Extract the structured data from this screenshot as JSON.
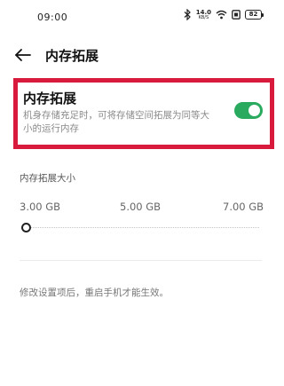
{
  "status_bar": {
    "time": "09:00",
    "net_speed_value": "14.0",
    "net_speed_unit": "KB/S",
    "battery": "82",
    "icons": [
      "bluetooth-icon",
      "wifi-icon",
      "sim-icon",
      "battery-icon"
    ]
  },
  "header": {
    "title": "内存拓展",
    "back_icon": "arrow-left-icon"
  },
  "setting": {
    "title": "内存拓展",
    "description": "机身存储充足时，可将存储空间拓展为同等大小的运行内存",
    "toggle_on": true,
    "toggle_color": "#2aaa5e",
    "highlight_color": "#d81a3c"
  },
  "size_section": {
    "label": "内存拓展大小",
    "options": [
      "3.00 GB",
      "5.00 GB",
      "7.00 GB"
    ],
    "selected_index": 0
  },
  "footer": {
    "note": "修改设置项后，重启手机才能生效。"
  }
}
